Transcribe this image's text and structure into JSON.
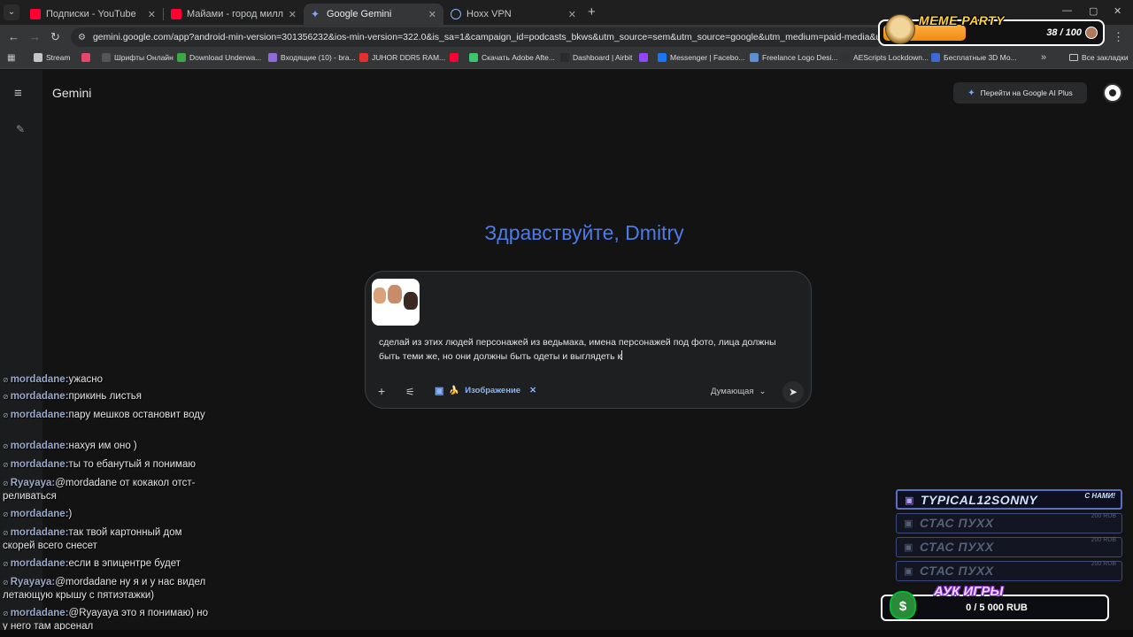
{
  "browser": {
    "tabs": [
      {
        "title": "Подписки - YouTube",
        "favicon": "youtube-icon",
        "color": "#ff0033"
      },
      {
        "title": "Майами - город миллиардер",
        "favicon": "youtube-icon",
        "color": "#ff0033"
      },
      {
        "title": "Google Gemini",
        "favicon": "gemini-icon",
        "color": "#7ca9ff",
        "active": true
      },
      {
        "title": "Hoxx VPN",
        "favicon": "globe-icon",
        "color": "#8ab4f8"
      }
    ],
    "url": "gemini.google.com/app?android-min-version=301356232&ios-min-version=322.0&is_sa=1&campaign_id=podcasts_bkws&utm_source=sem&utm_source=google&utm_medium=paid-media&utm_medium=cpc&ut",
    "bookmarks": [
      {
        "label": "Stream",
        "icon": "folder-icon",
        "color": "#c4c7c5"
      },
      {
        "label": "",
        "icon": "app-icon",
        "color": "#e8456b"
      },
      {
        "label": "Шрифты Онлайн",
        "icon": "font-icon",
        "color": "#555"
      },
      {
        "label": "Download Underwa...",
        "icon": "ae-icon",
        "color": "#39a845"
      },
      {
        "label": "Входящие (10) - bra...",
        "icon": "mail-icon",
        "color": "#8e6bd8"
      },
      {
        "label": "JUHOR DDR5 RAM...",
        "icon": "ali-icon",
        "color": "#e62e2e"
      },
      {
        "label": "",
        "icon": "youtube-icon",
        "color": "#ff0033"
      },
      {
        "label": "Скачать Adobe Afte...",
        "icon": "leaf-icon",
        "color": "#3ec46d"
      },
      {
        "label": "Dashboard | Airbit",
        "icon": "airbit-icon",
        "color": "#2b2b2b"
      },
      {
        "label": "",
        "icon": "twitch-icon",
        "color": "#9146ff"
      },
      {
        "label": "Messenger | Facebo...",
        "icon": "facebook-icon",
        "color": "#1877f2"
      },
      {
        "label": "Freelance Logo Desi...",
        "icon": "freelance-icon",
        "color": "#5b8fd6"
      },
      {
        "label": "AEScripts Lockdown...",
        "icon": "aescripts-icon",
        "color": "#333"
      },
      {
        "label": "Бесплатные 3D Мо...",
        "icon": "3d-icon",
        "color": "#3b6ad6"
      }
    ],
    "all_bookmarks": "Все закладки"
  },
  "meme_party": {
    "title": "MEME PARTY",
    "count": "38 / 100",
    "progress": 0.38
  },
  "gemini": {
    "app_title": "Gemini",
    "upgrade_label": "Перейти на Google AI Plus",
    "greeting": "Здравствуйте, Dmitry",
    "prompt_text": "сделай из этих людей персонажей из ведьмака, имена персонажей под фото, лица должны быть теми же, но они должны быть одеты и выглядеть к",
    "chip_label": "Изображение",
    "chip_emoji": "🍌",
    "mode_label": "Думающая"
  },
  "chat": [
    {
      "user": "mordadane:",
      "text": "ужасно"
    },
    {
      "user": "mordadane:",
      "text": "прикинь листья"
    },
    {
      "user": "mordadane:",
      "text": "пару мешков остановит воду"
    },
    {
      "user": "mordadane:",
      "text": "нахуя им оно )"
    },
    {
      "user": "mordadane:",
      "text": "ты то ебанутый я понимаю"
    },
    {
      "user": "Ryayaya:",
      "text": "@mordadane от кокакол отст-реливаться"
    },
    {
      "user": "mordadane:",
      "text": ")"
    },
    {
      "user": "mordadane:",
      "text": "так твой картонный дом скорей всего снесет"
    },
    {
      "user": "mordadane:",
      "text": "если в эпицентре будет"
    },
    {
      "user": "Ryayaya:",
      "text": "@mordadane ну я и у нас видел летающую крышу с пятиэтажки)"
    },
    {
      "user": "mordadane:",
      "text": "@Ryayaya это я понимаю) но у него там арсенал"
    }
  ],
  "donations": [
    {
      "name": "TYPICAL12SONNY",
      "amount": "С НАМИ!"
    },
    {
      "name": "СТАС ПУХХ",
      "amount": "200 RUB"
    },
    {
      "name": "СТАС ПУХХ",
      "amount": "200 RUB"
    },
    {
      "name": "СТАС ПУХХ",
      "amount": "200 RUB"
    }
  ],
  "auction": {
    "title": "АУК ИГРЫ",
    "value": "0 / 5 000 RUB"
  }
}
